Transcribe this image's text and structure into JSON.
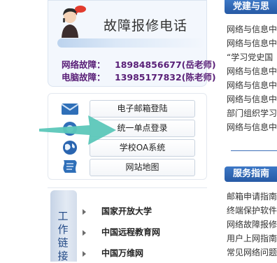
{
  "hotline": {
    "title": "故障报修电话",
    "rows": [
      {
        "label": "网络故障：",
        "value": "18984856677(岳老师)"
      },
      {
        "label": "电脑故障：",
        "value": "13985177832(陈老师)"
      }
    ]
  },
  "quick_links": [
    {
      "label": "电子邮箱登陆",
      "icon": "mail-icon"
    },
    {
      "label": "统一单点登录",
      "icon": "login-icon"
    },
    {
      "label": "学校OA系统",
      "icon": "globe-icon"
    },
    {
      "label": "网站地图",
      "icon": "map-icon"
    }
  ],
  "work_links": {
    "tab_label": "工作链接",
    "items": [
      "国家开放大学",
      "中国远程教育网",
      "中国万维网"
    ]
  },
  "party_section": {
    "title": "党建与思",
    "items": [
      "网络与信息中",
      "网络与信息中",
      "“学习党史国",
      "网络与信息中",
      "网络与信息中",
      "网络与信息中",
      "部门组织学习",
      "网络与信息中"
    ]
  },
  "service_section": {
    "title": "服务指南",
    "items": [
      "邮箱申请指南",
      "终端保护软件",
      "网络故障报修",
      "用户上网指南",
      "常见网络问题"
    ]
  },
  "colors": {
    "accent": "#2d63ad",
    "hotline_text": "#5a2078",
    "arrow": "#5cc7b9"
  }
}
